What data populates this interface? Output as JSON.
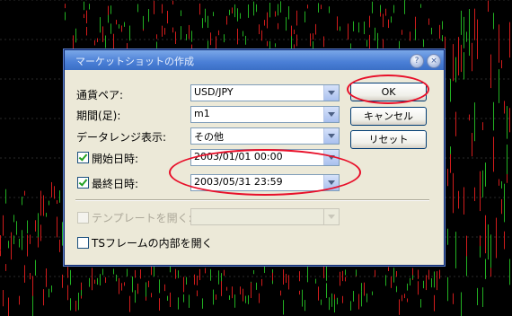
{
  "dialog": {
    "title": "マーケットショットの作成",
    "help_glyph": "?",
    "close_glyph": "×"
  },
  "form": {
    "pair_label": "通貨ペア:",
    "pair_value": "USD/JPY",
    "period_label": "期間(足):",
    "period_value": "m1",
    "range_label": "データレンジ表示:",
    "range_value": "その他",
    "start_label": "開始日時:",
    "start_value": "2003/01/01 00:00",
    "end_label": "最終日時:",
    "end_value": "2003/05/31 23:59",
    "template_label": "テンプレートを開く:",
    "template_value": "",
    "ts_label": "TSフレームの内部を開く"
  },
  "buttons": {
    "ok": "OK",
    "cancel": "キャンセル",
    "reset": "リセット"
  },
  "colors": {
    "annotation": "#e8102a",
    "candle_up": "#22b022",
    "candle_down": "#d21c1c"
  }
}
